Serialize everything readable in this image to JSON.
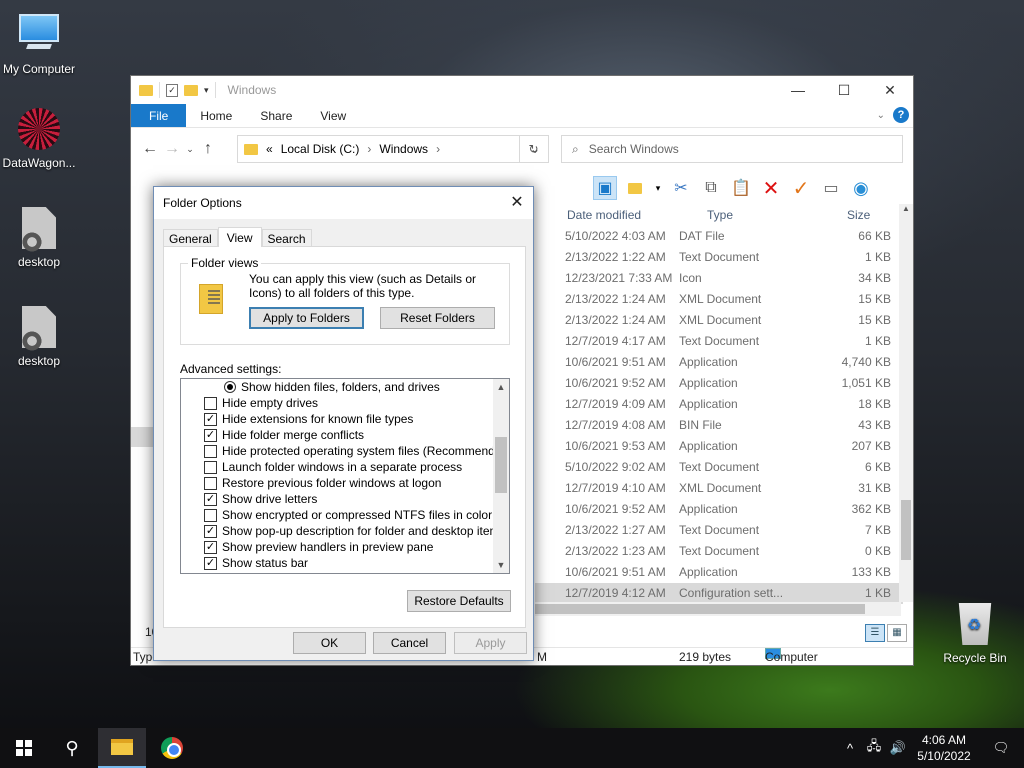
{
  "desktop": {
    "icons": [
      {
        "label": "My Computer"
      },
      {
        "label": "DataWagon..."
      },
      {
        "label": "desktop"
      },
      {
        "label": "desktop"
      },
      {
        "label": "Recycle Bin"
      }
    ]
  },
  "explorer": {
    "title": "Windows",
    "ribbon_tabs": [
      "File",
      "Home",
      "Share",
      "View"
    ],
    "address": {
      "prefix": "«",
      "parts": [
        "Local Disk (C:)",
        "Windows"
      ]
    },
    "search_placeholder": "Search Windows",
    "columns": [
      "Date modified",
      "Type",
      "Size"
    ],
    "rows": [
      {
        "date": "5/10/2022 4:03 AM",
        "type": "DAT File",
        "size": "66 KB"
      },
      {
        "date": "2/13/2022 1:22 AM",
        "type": "Text Document",
        "size": "1 KB"
      },
      {
        "date": "12/23/2021 7:33 AM",
        "type": "Icon",
        "size": "34 KB"
      },
      {
        "date": "2/13/2022 1:24 AM",
        "type": "XML Document",
        "size": "15 KB"
      },
      {
        "date": "2/13/2022 1:24 AM",
        "type": "XML Document",
        "size": "15 KB"
      },
      {
        "date": "12/7/2019 4:17 AM",
        "type": "Text Document",
        "size": "1 KB"
      },
      {
        "date": "10/6/2021 9:51 AM",
        "type": "Application",
        "size": "4,740 KB"
      },
      {
        "date": "10/6/2021 9:52 AM",
        "type": "Application",
        "size": "1,051 KB"
      },
      {
        "date": "12/7/2019 4:09 AM",
        "type": "Application",
        "size": "18 KB"
      },
      {
        "date": "12/7/2019 4:08 AM",
        "type": "BIN File",
        "size": "43 KB"
      },
      {
        "date": "10/6/2021 9:53 AM",
        "type": "Application",
        "size": "207 KB"
      },
      {
        "date": "5/10/2022 9:02 AM",
        "type": "Text Document",
        "size": "6 KB"
      },
      {
        "date": "12/7/2019 4:10 AM",
        "type": "XML Document",
        "size": "31 KB"
      },
      {
        "date": "10/6/2021 9:52 AM",
        "type": "Application",
        "size": "362 KB"
      },
      {
        "date": "2/13/2022 1:27 AM",
        "type": "Text Document",
        "size": "7 KB"
      },
      {
        "date": "2/13/2022 1:23 AM",
        "type": "Text Document",
        "size": "0 KB"
      },
      {
        "date": "10/6/2021 9:51 AM",
        "type": "Application",
        "size": "133 KB"
      },
      {
        "date": "12/7/2019 4:12 AM",
        "type": "Configuration sett...",
        "size": "1 KB"
      }
    ],
    "status": {
      "count_partial": "10",
      "type_partial": "Type",
      "m_partial": "M",
      "size": "219 bytes",
      "location": "Computer"
    }
  },
  "dialog": {
    "title": "Folder Options",
    "tabs": [
      "General",
      "View",
      "Search"
    ],
    "folder_views": {
      "legend": "Folder views",
      "text": "You can apply this view (such as Details or Icons) to all folders of this type.",
      "apply_label": "Apply to Folders",
      "reset_label": "Reset Folders"
    },
    "advanced_label": "Advanced settings:",
    "advanced_items": [
      {
        "kind": "radio",
        "checked": true,
        "label": "Show hidden files, folders, and drives"
      },
      {
        "kind": "check",
        "checked": false,
        "label": "Hide empty drives"
      },
      {
        "kind": "check",
        "checked": true,
        "label": "Hide extensions for known file types"
      },
      {
        "kind": "check",
        "checked": true,
        "label": "Hide folder merge conflicts"
      },
      {
        "kind": "check",
        "checked": false,
        "label": "Hide protected operating system files (Recommended)"
      },
      {
        "kind": "check",
        "checked": false,
        "label": "Launch folder windows in a separate process"
      },
      {
        "kind": "check",
        "checked": false,
        "label": "Restore previous folder windows at logon"
      },
      {
        "kind": "check",
        "checked": true,
        "label": "Show drive letters"
      },
      {
        "kind": "check",
        "checked": false,
        "label": "Show encrypted or compressed NTFS files in color"
      },
      {
        "kind": "check",
        "checked": true,
        "label": "Show pop-up description for folder and desktop items"
      },
      {
        "kind": "check",
        "checked": true,
        "label": "Show preview handlers in preview pane"
      },
      {
        "kind": "check",
        "checked": true,
        "label": "Show status bar"
      }
    ],
    "restore_defaults_label": "Restore Defaults",
    "ok_label": "OK",
    "cancel_label": "Cancel",
    "apply_label": "Apply"
  },
  "taskbar": {
    "time": "4:06 AM",
    "date": "5/10/2022"
  }
}
